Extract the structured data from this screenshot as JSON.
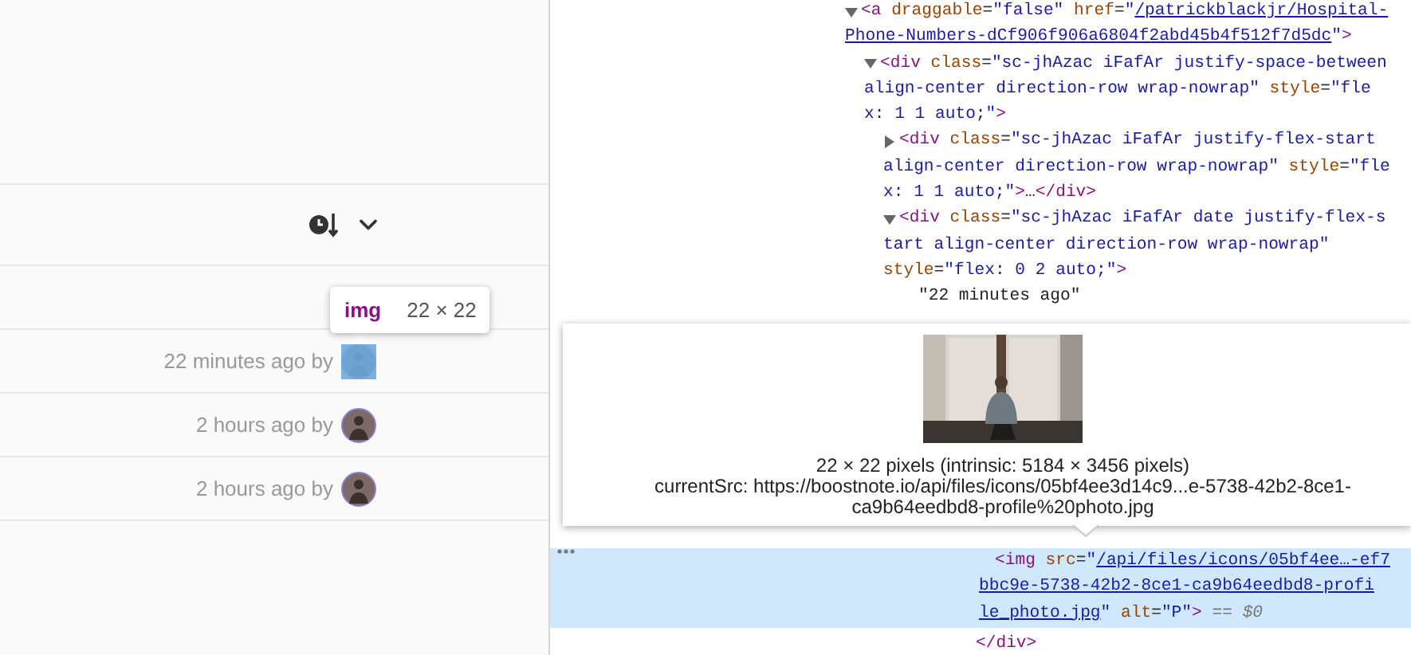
{
  "list": {
    "rows": [
      {
        "meta": "22 minutes ago by",
        "highlighted": true
      },
      {
        "meta": "2 hours ago by",
        "highlighted": false
      },
      {
        "meta": "2 hours ago by",
        "highlighted": false
      }
    ]
  },
  "element_label": {
    "tag": "img",
    "size": "22 × 22"
  },
  "dom_tree": [
    {
      "kind": "element",
      "expanded": true,
      "lines": [
        [
          {
            "kind": "tag",
            "text": "<a"
          },
          {
            "kind": "attr",
            "text": " draggable"
          },
          {
            "kind": "punct",
            "text": "="
          },
          {
            "kind": "value",
            "text": "\"false\""
          },
          {
            "kind": "attr",
            "text": " href"
          },
          {
            "kind": "punct",
            "text": "="
          },
          {
            "kind": "value",
            "text": "\""
          },
          {
            "kind": "link",
            "text": "/patrickblackjr/Hospital-"
          }
        ],
        [
          {
            "kind": "link",
            "text": "Phone-Numbers-dCf906f906a6804f2abd45b4f512f7d5dc"
          },
          {
            "kind": "value",
            "text": "\""
          },
          {
            "kind": "tag",
            "text": ">"
          }
        ]
      ],
      "children": [
        {
          "kind": "element",
          "expanded": true,
          "lines": [
            [
              {
                "kind": "tag",
                "text": "<div"
              },
              {
                "kind": "attr",
                "text": " class"
              },
              {
                "kind": "punct",
                "text": "="
              },
              {
                "kind": "value",
                "text": "\"sc-jhAzac iFafAr justify-space-between"
              }
            ],
            [
              {
                "kind": "value",
                "text": "align-center direction-row wrap-nowrap\""
              },
              {
                "kind": "attr",
                "text": " style"
              },
              {
                "kind": "punct",
                "text": "="
              },
              {
                "kind": "value",
                "text": "\"fle"
              }
            ],
            [
              {
                "kind": "value",
                "text": "x: 1 1 auto;\""
              },
              {
                "kind": "tag",
                "text": ">"
              }
            ]
          ],
          "children": [
            {
              "kind": "element",
              "expanded": false,
              "lines": [
                [
                  {
                    "kind": "tag",
                    "text": "<div"
                  },
                  {
                    "kind": "attr",
                    "text": " class"
                  },
                  {
                    "kind": "punct",
                    "text": "="
                  },
                  {
                    "kind": "value",
                    "text": "\"sc-jhAzac iFafAr justify-flex-start"
                  }
                ],
                [
                  {
                    "kind": "value",
                    "text": "align-center direction-row wrap-nowrap\""
                  },
                  {
                    "kind": "attr",
                    "text": " style"
                  },
                  {
                    "kind": "punct",
                    "text": "="
                  },
                  {
                    "kind": "value",
                    "text": "\"fle"
                  }
                ],
                [
                  {
                    "kind": "value",
                    "text": "x: 1 1 auto;\""
                  },
                  {
                    "kind": "tag",
                    "text": ">"
                  },
                  {
                    "kind": "text",
                    "text": "…"
                  },
                  {
                    "kind": "tag",
                    "text": "</div>"
                  }
                ]
              ]
            },
            {
              "kind": "element",
              "expanded": true,
              "lines": [
                [
                  {
                    "kind": "tag",
                    "text": "<div"
                  },
                  {
                    "kind": "attr",
                    "text": " class"
                  },
                  {
                    "kind": "punct",
                    "text": "="
                  },
                  {
                    "kind": "value",
                    "text": "\"sc-jhAzac iFafAr date justify-flex-s"
                  }
                ],
                [
                  {
                    "kind": "value",
                    "text": "tart align-center direction-row wrap-nowrap\""
                  }
                ],
                [
                  {
                    "kind": "attr",
                    "text": "style"
                  },
                  {
                    "kind": "punct",
                    "text": "="
                  },
                  {
                    "kind": "value",
                    "text": "\"flex: 0 2 auto;\""
                  },
                  {
                    "kind": "tag",
                    "text": ">"
                  }
                ]
              ],
              "children": [
                {
                  "kind": "text",
                  "lines": [
                    [
                      {
                        "kind": "text",
                        "text": "\"22 minutes ago\""
                      }
                    ]
                  ]
                }
              ]
            }
          ]
        }
      ]
    }
  ],
  "dom_tail": {
    "lines": [
      [
        {
          "kind": "tag",
          "text": "</div>"
        }
      ]
    ],
    "children": [
      {
        "kind": "element",
        "selected": true,
        "lines": [
          [
            {
              "kind": "tag",
              "text": "<img"
            },
            {
              "kind": "attr",
              "text": " src"
            },
            {
              "kind": "punct",
              "text": "="
            },
            {
              "kind": "value",
              "text": "\""
            },
            {
              "kind": "link",
              "text": "/api/files/icons/05bf4ee…-ef7"
            }
          ],
          [
            {
              "kind": "link",
              "text": "bbc9e-5738-42b2-8ce1-ca9b64eedbd8-profi"
            }
          ],
          [
            {
              "kind": "link",
              "text": "le_photo.jpg"
            },
            {
              "kind": "value",
              "text": "\""
            },
            {
              "kind": "attr",
              "text": " alt"
            },
            {
              "kind": "punct",
              "text": "="
            },
            {
              "kind": "value",
              "text": "\"P\""
            },
            {
              "kind": "tag",
              "text": ">"
            },
            {
              "kind": "dollar",
              "text": " == $0"
            }
          ]
        ]
      }
    ]
  },
  "image_preview": {
    "dimensions": "22 × 22 pixels (intrinsic: 5184 × 3456 pixels)",
    "current_src": [
      "currentSrc: https://boostnote.io/api/files/icons/05bf4ee3d14c9...e-5738-42b2-8ce1-",
      "ca9b64eedbd8-profile%20photo.jpg"
    ]
  }
}
